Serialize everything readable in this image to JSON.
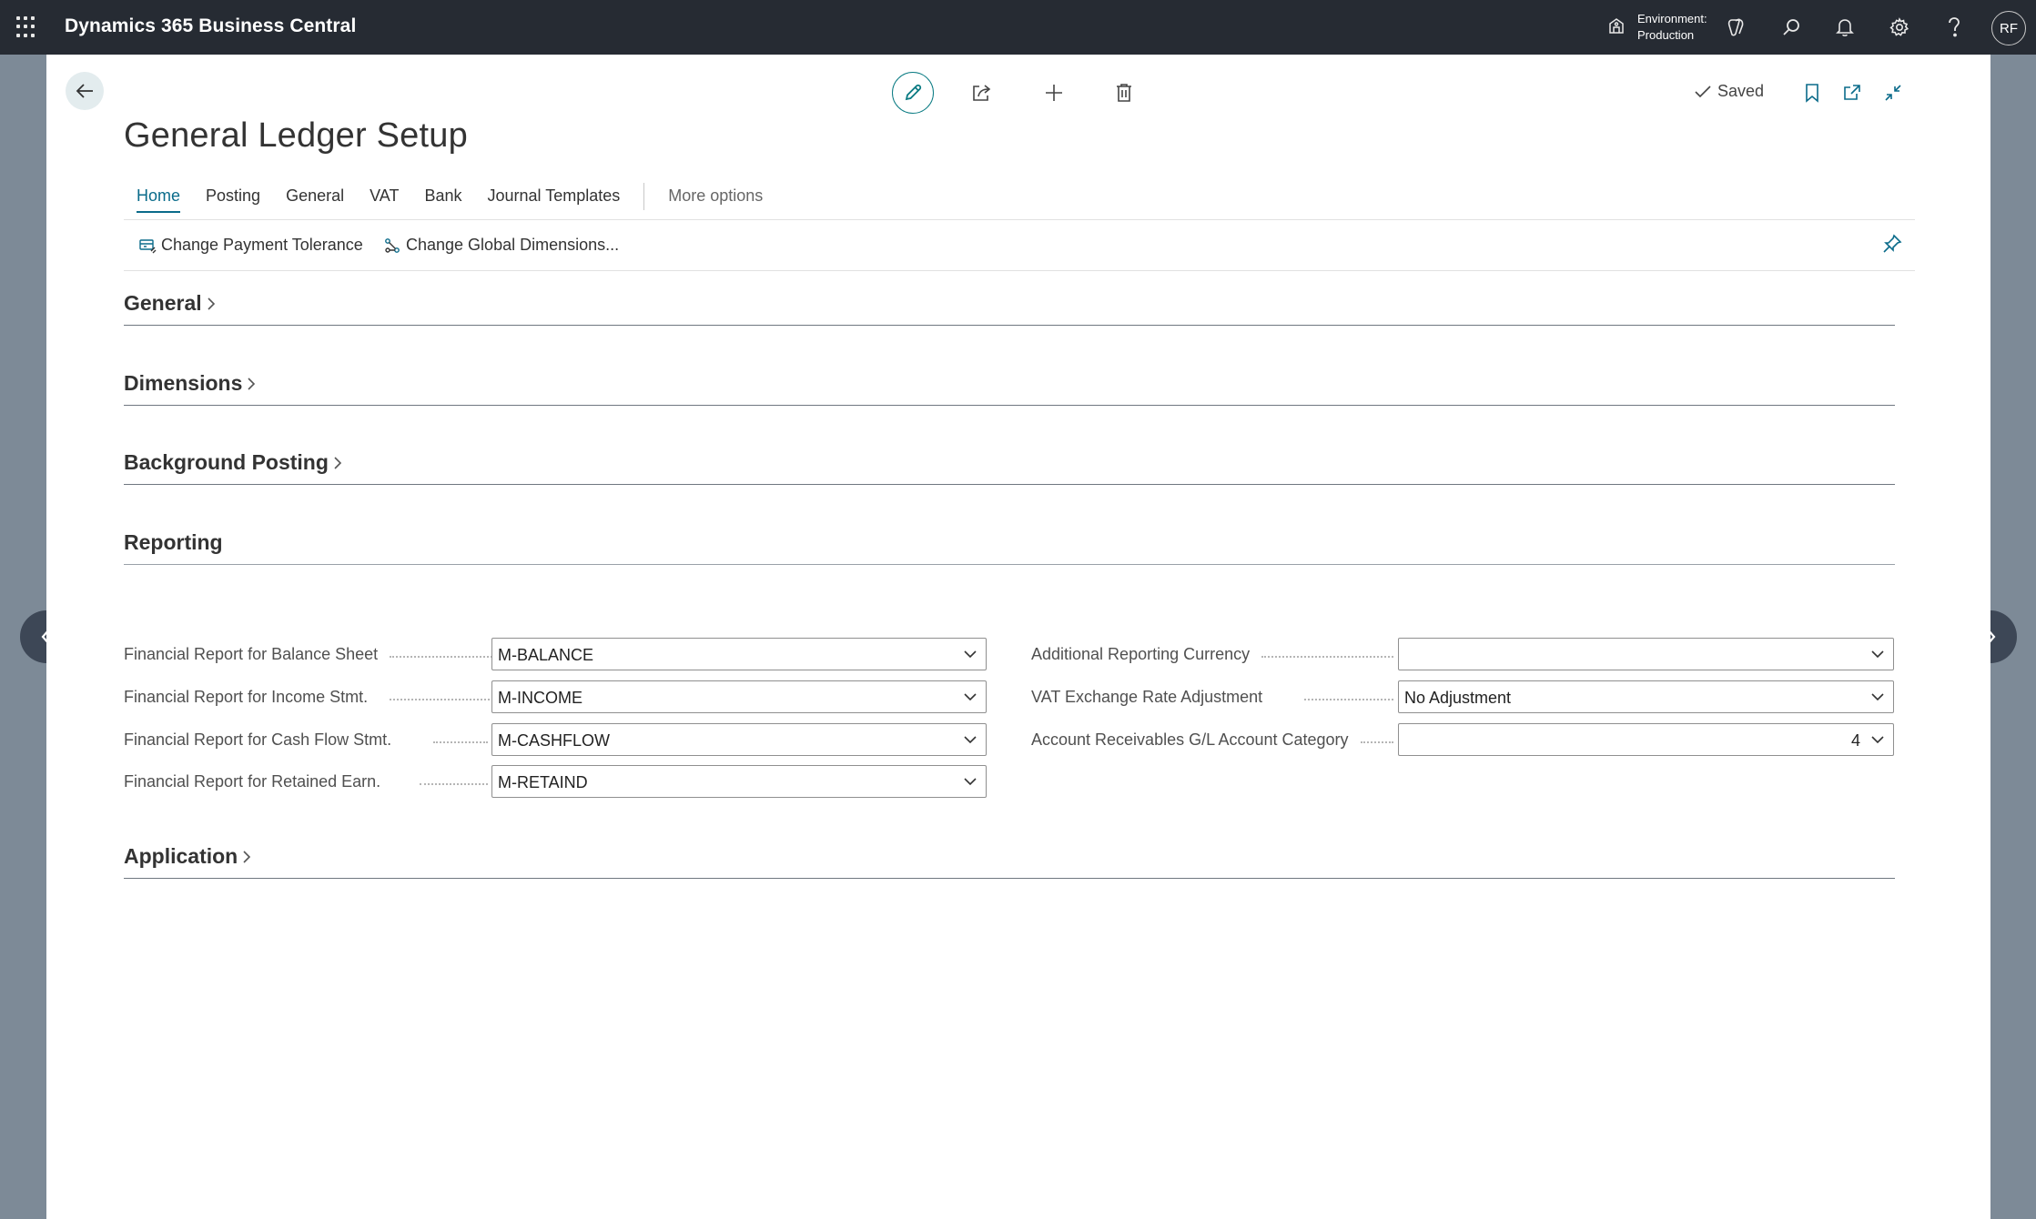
{
  "topbar": {
    "app_title": "Dynamics 365 Business Central",
    "environment_label": "Environment:",
    "environment_value": "Production",
    "user_initials": "RF",
    "icons": [
      "app-launcher-icon",
      "environment-icon",
      "copilot-icon",
      "search-icon",
      "bell-icon",
      "gear-icon",
      "help-icon"
    ]
  },
  "actions": {
    "saved_label": "Saved",
    "icons": [
      "back-arrow-icon",
      "edit-pencil-icon",
      "share-icon",
      "plus-icon",
      "trash-icon",
      "bookmark-icon",
      "open-new-window-icon",
      "collapse-icon"
    ]
  },
  "page": {
    "title": "General Ledger Setup"
  },
  "tabs": [
    {
      "label": "Home",
      "active": true
    },
    {
      "label": "Posting"
    },
    {
      "label": "General"
    },
    {
      "label": "VAT"
    },
    {
      "label": "Bank"
    },
    {
      "label": "Journal Templates"
    }
  ],
  "more_options": "More options",
  "action_bar": {
    "change_payment_tolerance": "Change Payment Tolerance",
    "change_global_dimensions": "Change Global Dimensions..."
  },
  "sections": {
    "general": "General",
    "dimensions": "Dimensions",
    "background_posting": "Background Posting",
    "reporting": "Reporting",
    "application": "Application"
  },
  "reporting_fields": {
    "left": [
      {
        "label": "Financial Report for Balance Sheet",
        "value": "M-BALANCE"
      },
      {
        "label": "Financial Report for Income Stmt.",
        "value": "M-INCOME"
      },
      {
        "label": "Financial Report for Cash Flow Stmt.",
        "value": "M-CASHFLOW"
      },
      {
        "label": "Financial Report for Retained Earn.",
        "value": "M-RETAIND"
      }
    ],
    "right": [
      {
        "label": "Additional Reporting Currency",
        "value": ""
      },
      {
        "label": "VAT Exchange Rate Adjustment",
        "value": "No Adjustment"
      },
      {
        "label": "Account Receivables G/L Account Category",
        "value": "4"
      }
    ]
  },
  "colors": {
    "topbar_bg": "#262b33",
    "accent": "#0a6b8a",
    "edit_ring": "#0a7b83",
    "backdrop": "#7d8a97"
  }
}
